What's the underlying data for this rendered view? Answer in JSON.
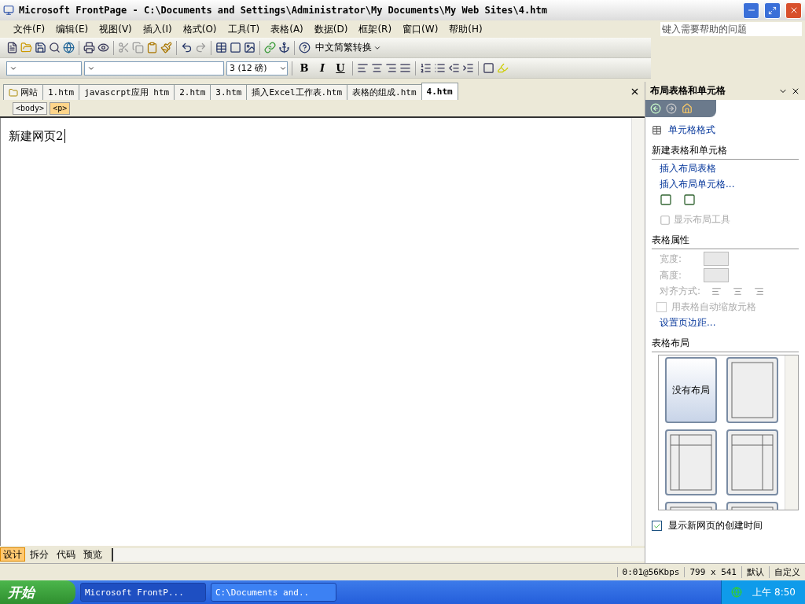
{
  "window": {
    "title": "Microsoft FrontPage - C:\\Documents and Settings\\Administrator\\My Documents\\My Web Sites\\4.htm"
  },
  "menu": [
    "文件(F)",
    "编辑(E)",
    "视图(V)",
    "插入(I)",
    "格式(O)",
    "工具(T)",
    "表格(A)",
    "数据(D)",
    "框架(R)",
    "窗口(W)",
    "帮助(H)"
  ],
  "help_box": {
    "placeholder": "键入需要帮助的问题"
  },
  "standard_toolbar": {
    "convert_button": "中文简繁转换"
  },
  "format_toolbar": {
    "font_size": "3 (12 磅)",
    "style_buttons": [
      "B",
      "I",
      "U"
    ]
  },
  "tabs": [
    {
      "label": "网站",
      "selected": false,
      "kind": "site"
    },
    {
      "label": "1.htm",
      "selected": false,
      "kind": "page"
    },
    {
      "label": "javascrpt应用 htm",
      "selected": false,
      "kind": "page"
    },
    {
      "label": "2.htm",
      "selected": false,
      "kind": "page"
    },
    {
      "label": "3.htm",
      "selected": false,
      "kind": "page"
    },
    {
      "label": "插入Excel工作表.htm",
      "selected": false,
      "kind": "page"
    },
    {
      "label": "表格的组成.htm",
      "selected": false,
      "kind": "page"
    },
    {
      "label": "4.htm",
      "selected": true,
      "kind": "page"
    }
  ],
  "tag_path": [
    {
      "label": "<body>",
      "selected": false
    },
    {
      "label": "<p>",
      "selected": true
    }
  ],
  "document": {
    "text": "新建网页2"
  },
  "view_tabs": [
    {
      "label": "设计",
      "selected": true
    },
    {
      "label": "拆分",
      "selected": false
    },
    {
      "label": "代码",
      "selected": false
    },
    {
      "label": "预览",
      "selected": false
    }
  ],
  "status_bar": [
    "0:01@56Kbps",
    "799 x 541",
    "默认",
    "自定义"
  ],
  "task_pane": {
    "title": "布局表格和单元格",
    "format_link": "单元格格式",
    "sections": [
      {
        "heading": "新建表格和单元格",
        "links": [
          "插入布局表格",
          "插入布局单元格..."
        ],
        "show_tools": {
          "label": "显示布局工具",
          "disabled": true
        }
      },
      {
        "heading": "表格属性",
        "disabled": true,
        "fields": [
          "宽度:",
          "高度:"
        ],
        "align_label": "对齐方式:",
        "autofit": {
          "label": "用表格自动缩放元格",
          "checked": false
        },
        "margin_link": "设置页边距..."
      },
      {
        "heading": "表格布局"
      }
    ],
    "layouts": [
      {
        "kind": "none",
        "label": "没有布局",
        "selected": true
      },
      {
        "kind": "blank",
        "selected": false
      },
      {
        "kind": "left",
        "selected": false
      },
      {
        "kind": "right",
        "selected": false
      },
      {
        "kind": "top",
        "selected": false
      },
      {
        "kind": "top",
        "selected": false
      }
    ],
    "show_time": {
      "label": "显示新网页的创建时间",
      "checked": true
    }
  },
  "taskbar": {
    "start": "开始",
    "tasks": [
      {
        "label": "Microsoft FrontP...",
        "selected": true
      },
      {
        "label": "C:\\Documents and..",
        "selected": false
      }
    ],
    "clock": "上午 8:50"
  }
}
